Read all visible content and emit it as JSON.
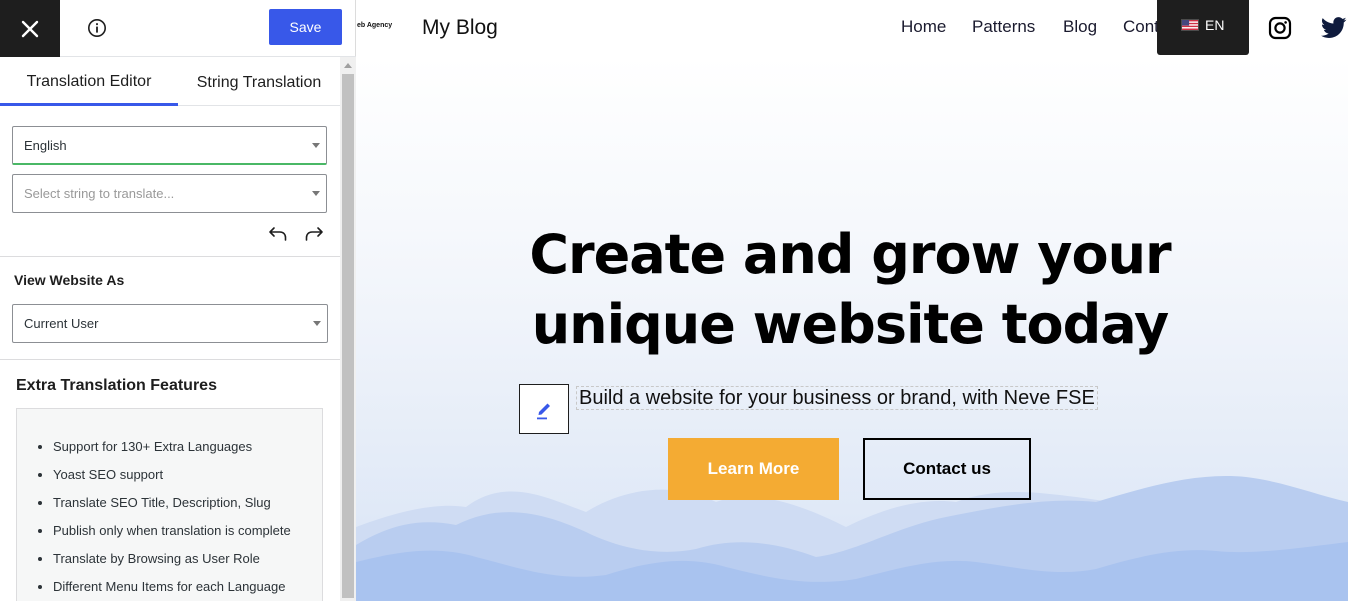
{
  "editor": {
    "save_label": "Save",
    "tabs": [
      {
        "label": "Translation Editor",
        "active": true
      },
      {
        "label": "String Translation",
        "active": false
      }
    ],
    "language_select": {
      "value": "English"
    },
    "string_select": {
      "placeholder": "Select string to translate..."
    },
    "view_as": {
      "label": "View Website As",
      "value": "Current User"
    },
    "extra_features": {
      "heading": "Extra Translation Features",
      "items": [
        "Support for 130+ Extra Languages",
        "Yoast SEO support",
        "Translate SEO Title, Description, Slug",
        "Publish only when translation is complete",
        "Translate by Browsing as User Role",
        "Different Menu Items for each Language"
      ]
    },
    "colors": {
      "primary": "#3858e9",
      "close_bg": "#1e1e1e",
      "focus_green": "#4ab866"
    }
  },
  "site": {
    "logo_text": "eb Agency",
    "title": "My Blog",
    "nav": [
      "Home",
      "Patterns",
      "Blog",
      "Cont"
    ],
    "language_switcher": {
      "flag": "us-flag-icon",
      "code": "EN"
    },
    "social": [
      "instagram-icon",
      "twitter-icon"
    ],
    "hero": {
      "title_line1": "Create and grow your",
      "title_line2": "unique website today",
      "subtitle": "Build a website for your business or brand, with Neve FSE",
      "primary_button": "Learn More",
      "secondary_button": "Contact us"
    },
    "colors": {
      "accent": "#f4ab33",
      "text": "#000000",
      "mountains": "#a9c3ef"
    }
  }
}
